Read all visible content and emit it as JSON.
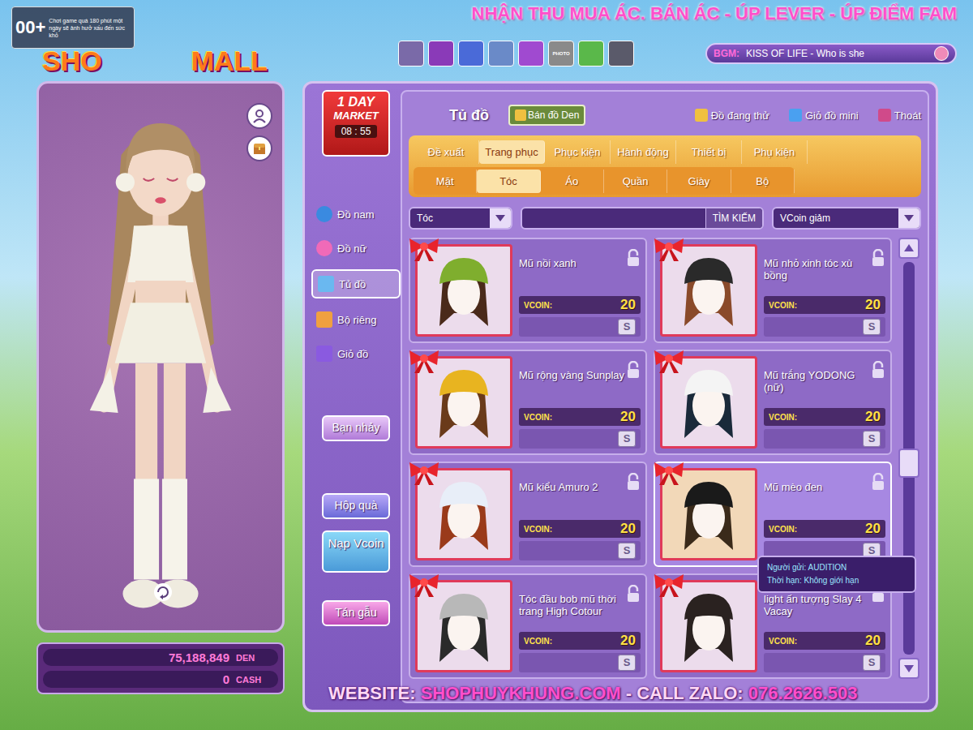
{
  "warning": {
    "badge": "00+",
    "text": "Chơi game quá 180 phút một ngày sẽ ảnh hưở xấu đến sức khỏ"
  },
  "logo": {
    "left": "SHO",
    "right": "MALL"
  },
  "banner": "NHẬN THU MUA ÁC. BÁN ÁC - ÚP LEVER - ÚP ĐIỂM FAM",
  "toolbar": [
    {
      "label": ""
    },
    {
      "label": ""
    },
    {
      "label": ""
    },
    {
      "label": ""
    },
    {
      "label": ""
    },
    {
      "label": "PHOTO"
    },
    {
      "label": ""
    },
    {
      "label": ""
    }
  ],
  "bgm": {
    "label": "BGM:",
    "track": "KISS OF LIFE - Who is she"
  },
  "market": {
    "line1": "1 DAY",
    "line2": "MARKET",
    "timer": "08 : 55"
  },
  "sidebar": {
    "items": [
      {
        "label": "Đồ nam",
        "selected": false
      },
      {
        "label": "Đồ nữ",
        "selected": false
      },
      {
        "label": "Tủ đồ",
        "selected": true
      },
      {
        "label": "Bộ riêng",
        "selected": false
      },
      {
        "label": "Giỏ đồ",
        "selected": false
      }
    ]
  },
  "side_buttons": [
    "Bạn nhảy",
    "Hộp quà",
    "Nạp Vcoin",
    "Tán gẫu"
  ],
  "balance": [
    {
      "amount": "75,188,849",
      "currency": "DEN"
    },
    {
      "amount": "0",
      "currency": "CASH"
    }
  ],
  "panel": {
    "title": "Tủ đồ",
    "sell_button": "Bán đồ Den",
    "actions": [
      {
        "label": "Đồ đang thử"
      },
      {
        "label": "Giỏ đồ mini"
      },
      {
        "label": "Thoát"
      }
    ]
  },
  "category_tabs": [
    {
      "label": "Đề xuất",
      "selected": false
    },
    {
      "label": "Trang phục",
      "selected": true
    },
    {
      "label": "Phục kiện",
      "selected": false
    },
    {
      "label": "Hành động",
      "selected": false
    },
    {
      "label": "Thiết bị",
      "selected": false
    },
    {
      "label": "Phụ kiện",
      "selected": false
    }
  ],
  "sub_tabs": [
    {
      "label": "Mặt",
      "selected": false
    },
    {
      "label": "Tóc",
      "selected": true
    },
    {
      "label": "Áo",
      "selected": false
    },
    {
      "label": "Quần",
      "selected": false
    },
    {
      "label": "Giày",
      "selected": false
    },
    {
      "label": "Bộ",
      "selected": false
    }
  ],
  "filter": {
    "category": "Tóc",
    "search_button": "TÌM KIẾM",
    "sort": "VCoin giảm"
  },
  "items": [
    {
      "name": "Mũ nồi xanh",
      "price_label": "VCOIN:",
      "price": "20",
      "button": "S",
      "selected": false
    },
    {
      "name": "Mũ nhỏ xinh tóc xù bồng",
      "price_label": "VCOIN:",
      "price": "20",
      "button": "S",
      "selected": false
    },
    {
      "name": "Mũ rộng vàng Sunplay",
      "price_label": "VCOIN:",
      "price": "20",
      "button": "S",
      "selected": false
    },
    {
      "name": "Mũ trắng YODONG (nữ)",
      "price_label": "VCOIN:",
      "price": "20",
      "button": "S",
      "selected": false
    },
    {
      "name": "Mũ kiểu Amuro 2",
      "price_label": "VCOIN:",
      "price": "20",
      "button": "S",
      "selected": false
    },
    {
      "name": "Mũ mèo đen",
      "price_label": "VCOIN:",
      "price": "20",
      "button": "S",
      "selected": true
    },
    {
      "name": "Tóc đầu bob mũ thời trang High Cotour",
      "price_label": "VCOIN:",
      "price": "20",
      "button": "S",
      "selected": false
    },
    {
      "name": "light ấn tượng Slay 4 Vacay",
      "price_label": "VCOIN:",
      "price": "20",
      "button": "S",
      "selected": false
    }
  ],
  "tooltip": {
    "sender": "Người gửi: AUDITION",
    "duration": "Thời hạn: Không giới hạn"
  },
  "footer": {
    "prefix": "WEBSITE: ",
    "site": "SHOPHUYKHUNG.COM",
    "middle": " - CALL ZALO: ",
    "phone": "076.2626.503"
  }
}
